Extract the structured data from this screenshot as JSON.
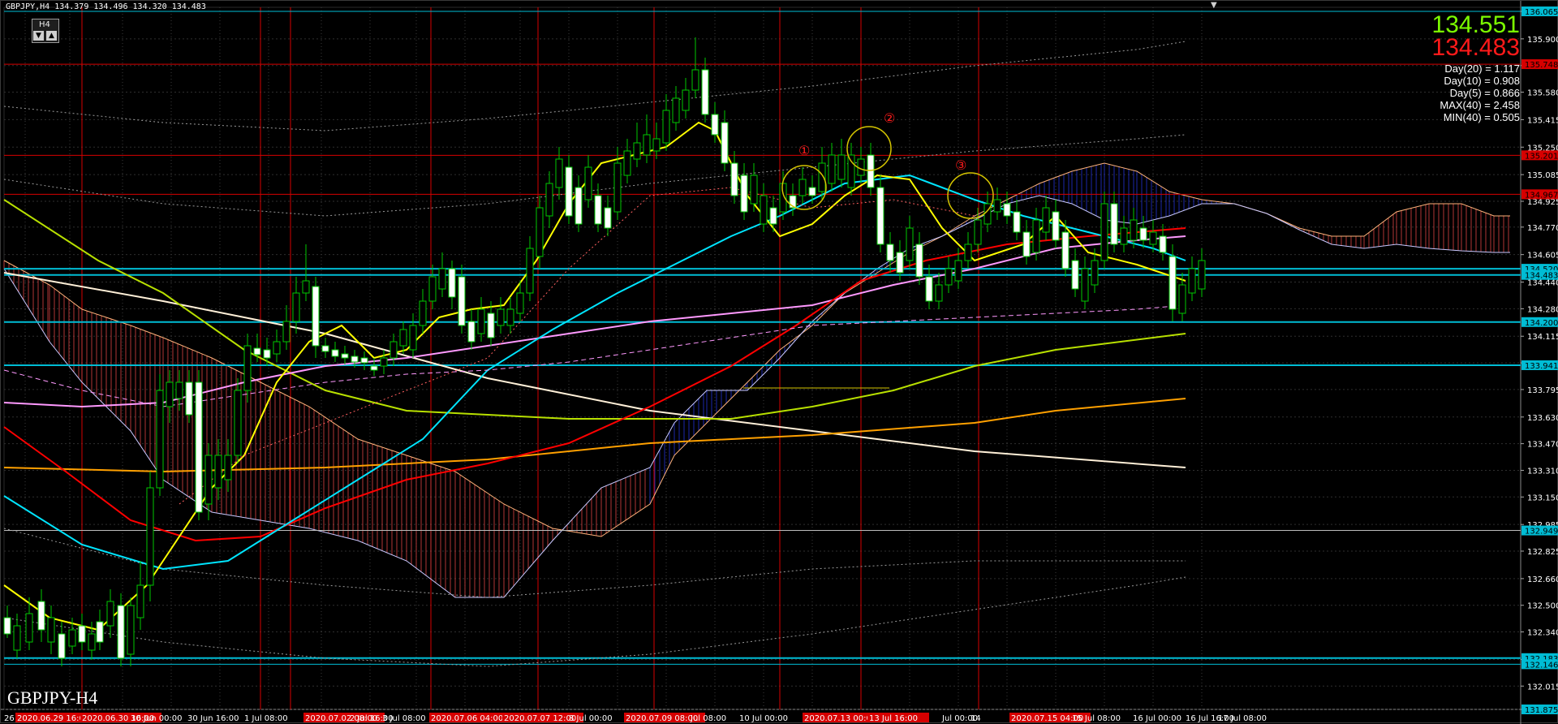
{
  "header": {
    "symbol_info": "GBPJPY,H4  134.379 134.496 134.320 134.483",
    "timeframe_widget": "H4",
    "down_arrow": "▼",
    "up_arrow": "▲",
    "collapse_arrow": "▼"
  },
  "quote": {
    "bid": "134.551",
    "ask": "134.483",
    "bid_color": "#7cfc00",
    "ask_color": "#ff1a1a",
    "stats": [
      "Day(20) = 1.117",
      "Day(10) = 0.908",
      "Day(5) = 0.866",
      "MAX(40) = 2.458",
      "MIN(40) = 0.505"
    ]
  },
  "symbol_timeframe_label": "GBPJPY-H4",
  "price_axis": {
    "ticks": [
      "136.065",
      "135.900",
      "135.740",
      "135.580",
      "135.415",
      "135.250",
      "135.085",
      "134.925",
      "134.770",
      "134.605",
      "134.440",
      "134.280",
      "134.115",
      "133.955",
      "133.795",
      "133.630",
      "133.470",
      "133.310",
      "133.150",
      "132.985",
      "132.825",
      "132.660",
      "132.500",
      "132.340",
      "132.175",
      "132.015",
      "131.875"
    ],
    "tagged_levels": [
      {
        "price": "136.065",
        "color": "#00bcd4"
      },
      {
        "price": "135.748",
        "color": "#d60000"
      },
      {
        "price": "135.201",
        "color": "#d60000"
      },
      {
        "price": "134.967",
        "color": "#d60000"
      },
      {
        "price": "134.520",
        "color": "#00bcd4"
      },
      {
        "price": "134.483",
        "color": "#00bcd4"
      },
      {
        "price": "134.200",
        "color": "#00bcd4"
      },
      {
        "price": "133.941",
        "color": "#00bcd4"
      },
      {
        "price": "132.949",
        "color": "#00bcd4"
      },
      {
        "price": "132.183",
        "color": "#00bcd4"
      },
      {
        "price": "132.146",
        "color": "#00bcd4"
      },
      {
        "price": "131.875",
        "color": "#00bcd4"
      }
    ]
  },
  "time_axis": {
    "labels": [
      "26",
      "2020.06.29 16:00",
      "2020.06.30 16:00",
      "30 Jun 00:00",
      "30 Jun 16:00",
      "1 Jul 08:00",
      "2020.07.02 08:00",
      "2 Jul 16:00",
      "3 Jul 08:00",
      "2020.07.06 04:00",
      "2020.07.07 12:00",
      "8 Jul 00:00",
      "2020.07.09 08:00",
      "Jul 08:00",
      "10 Jul 00:00",
      "2020.07.13 00:00",
      "13 Jul 16:00",
      "Jul 00:00",
      "14",
      "2020.07.15 04:00",
      "15 Jul 08:00",
      "16 Jul 00:00",
      "16 Jul 16:00",
      "17 Jul 08:00"
    ]
  },
  "annotations": [
    {
      "label": "①",
      "color": "#ff1a1a"
    },
    {
      "label": "②",
      "color": "#ff1a1a"
    },
    {
      "label": "③",
      "color": "#ff1a1a"
    }
  ],
  "colors": {
    "background": "#000000",
    "candle_up": "#00c800",
    "candle_down": "#ffffff",
    "grid_red": "#d60000",
    "horizontal_cyan": "#00bcd4",
    "ma_yellow": "#ffff00",
    "ma_cyan": "#00e5ff",
    "ma_red": "#ff0000",
    "ma_pink": "#ff99ff",
    "ma_yellowgreen": "#b8e000",
    "ma_orange": "#ffa000",
    "ma_white": "#fff0d8",
    "cloud_blue": "#2030c8",
    "cloud_red": "#d04040"
  }
}
